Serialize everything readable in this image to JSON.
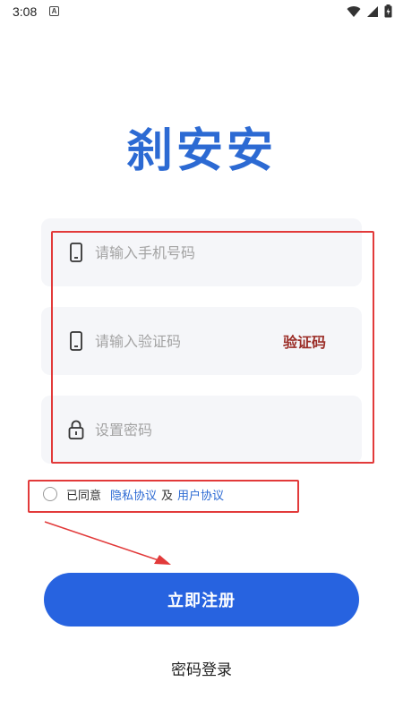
{
  "status_bar": {
    "time": "3:08",
    "notification_badge": "A",
    "icons": [
      "wifi-icon",
      "signal-icon",
      "battery-icon"
    ]
  },
  "app": {
    "title": "刹安安"
  },
  "form": {
    "phone_placeholder": "请输入手机号码",
    "code_placeholder": "请输入验证码",
    "code_button": "验证码",
    "password_placeholder": "设置密码"
  },
  "agreement": {
    "prefix": "已同意",
    "privacy_link": "隐私协议",
    "separator": "及",
    "user_link": "用户协议",
    "checked": false
  },
  "actions": {
    "register": "立即注册",
    "password_login": "密码登录"
  },
  "colors": {
    "brand": "#2c6ad3",
    "button": "#2763e0",
    "code_text": "#9b2d27",
    "annotation": "#e23a3a",
    "field_bg": "#f5f6f9"
  }
}
